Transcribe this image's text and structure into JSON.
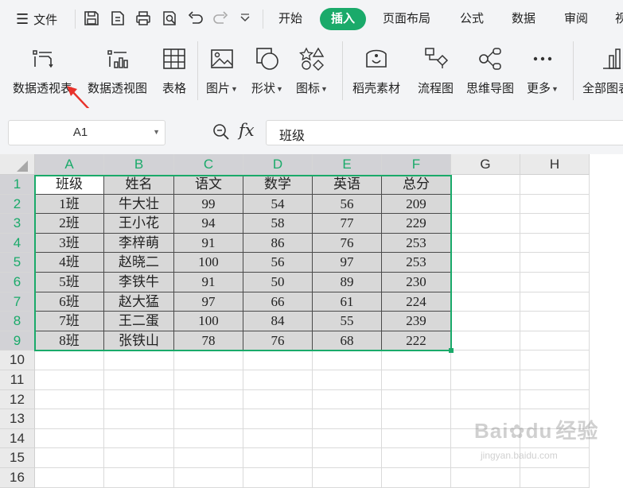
{
  "menu": {
    "file_label": "文件"
  },
  "tabs": [
    {
      "label": "开始",
      "active": false
    },
    {
      "label": "插入",
      "active": true
    },
    {
      "label": "页面布局",
      "active": false
    },
    {
      "label": "公式",
      "active": false
    },
    {
      "label": "数据",
      "active": false
    },
    {
      "label": "审阅",
      "active": false
    },
    {
      "label": "视",
      "active": false
    }
  ],
  "tools": {
    "pivot_table": "数据透视表",
    "pivot_chart": "数据透视图",
    "table": "表格",
    "picture": "图片",
    "shape": "形状",
    "icon": "图标",
    "daoke": "稻壳素材",
    "flowchart": "流程图",
    "mindmap": "思维导图",
    "more": "更多",
    "all_charts": "全部图表"
  },
  "formula_bar": {
    "name_box": "A1",
    "fx_label": "fx",
    "content": "班级"
  },
  "sheet": {
    "columns": [
      "A",
      "B",
      "C",
      "D",
      "E",
      "F",
      "G",
      "H"
    ],
    "rows": [
      "1",
      "2",
      "3",
      "4",
      "5",
      "6",
      "7",
      "8",
      "9",
      "10",
      "11",
      "12",
      "13",
      "14",
      "15",
      "16"
    ],
    "data": [
      [
        "班级",
        "姓名",
        "语文",
        "数学",
        "英语",
        "总分"
      ],
      [
        "1班",
        "牛大壮",
        "99",
        "54",
        "56",
        "209"
      ],
      [
        "2班",
        "王小花",
        "94",
        "58",
        "77",
        "229"
      ],
      [
        "3班",
        "李梓萌",
        "91",
        "86",
        "76",
        "253"
      ],
      [
        "4班",
        "赵晓二",
        "100",
        "56",
        "97",
        "253"
      ],
      [
        "5班",
        "李铁牛",
        "91",
        "50",
        "89",
        "230"
      ],
      [
        "6班",
        "赵大猛",
        "97",
        "66",
        "61",
        "224"
      ],
      [
        "7班",
        "王二蛋",
        "100",
        "84",
        "55",
        "239"
      ],
      [
        "8班",
        "张铁山",
        "78",
        "76",
        "68",
        "222"
      ]
    ]
  },
  "colors": {
    "accent": "#1aaa6a",
    "arrow": "#e8322b",
    "selected_fill": "#d8d8d8"
  },
  "watermark": {
    "brand": "Bai",
    "brand2": "du",
    "suffix": "经验",
    "url": "jingyan.baidu.com"
  }
}
